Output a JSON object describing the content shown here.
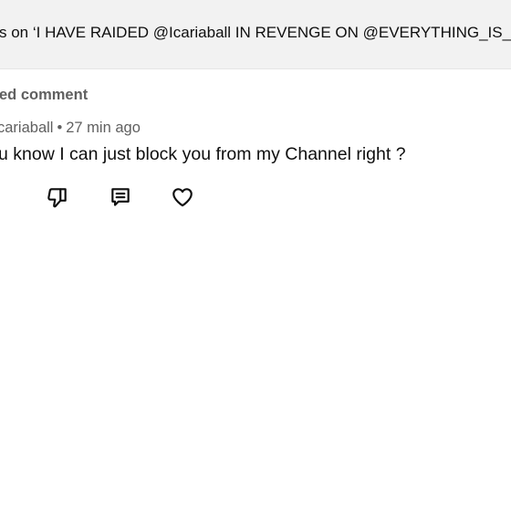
{
  "header": {
    "title": "s on ‘I HAVE RAIDED @Icariaball IN REVENGE ON @EVERYTHING_IS_PC"
  },
  "comment": {
    "highlight_label": "ed comment",
    "author": "cariaball",
    "separator": "•",
    "time": "27 min ago",
    "text": "u know I can just block you from my Channel right ?"
  },
  "actions": {
    "icons": [
      "thumbs-down-icon",
      "reply-icon",
      "heart-icon"
    ]
  }
}
